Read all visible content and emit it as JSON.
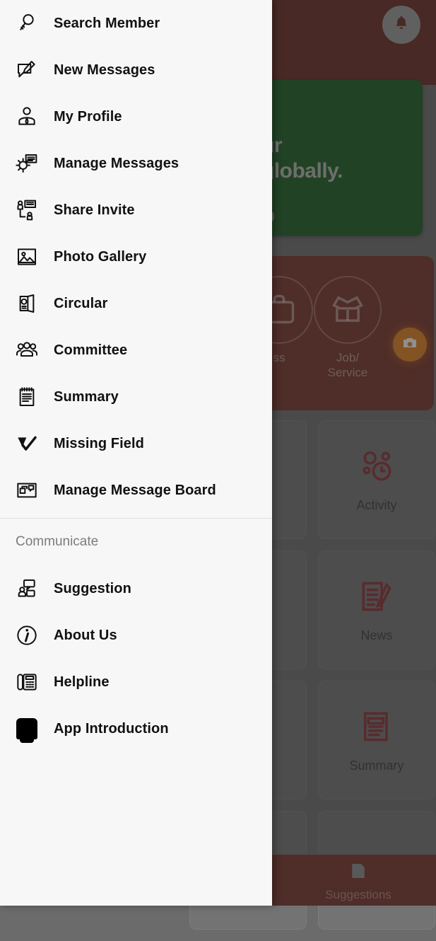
{
  "drawer": {
    "items": [
      {
        "label": "Search Member",
        "icon": "search-icon"
      },
      {
        "label": "New Messages",
        "icon": "new-message-icon"
      },
      {
        "label": "My Profile",
        "icon": "profile-icon"
      },
      {
        "label": "Manage Messages",
        "icon": "manage-messages-icon"
      },
      {
        "label": "Share Invite",
        "icon": "share-invite-icon"
      },
      {
        "label": "Photo Gallery",
        "icon": "photo-gallery-icon"
      },
      {
        "label": "Circular",
        "icon": "circular-icon"
      },
      {
        "label": "Committee",
        "icon": "committee-icon"
      },
      {
        "label": "Summary",
        "icon": "summary-icon"
      },
      {
        "label": "Missing Field",
        "icon": "missing-field-icon"
      },
      {
        "label": "Manage Message Board",
        "icon": "message-board-icon"
      }
    ],
    "section_title": "Communicate",
    "section_items": [
      {
        "label": "Suggestion",
        "icon": "suggestion-icon"
      },
      {
        "label": "About Us",
        "icon": "info-icon"
      },
      {
        "label": "Helpline",
        "icon": "telephone-icon"
      },
      {
        "label": "App Introduction",
        "icon": "app-intro-icon"
      }
    ]
  },
  "background": {
    "header": {
      "notification_icon": "bell-icon"
    },
    "banner": {
      "line1": "ur",
      "line2": "globally."
    },
    "tiles": [
      {
        "label": "ss",
        "icon": "briefcase-icon"
      },
      {
        "label": "Job/\nService",
        "icon": "open-box-icon"
      }
    ],
    "fab": {
      "icon": "camera-icon"
    },
    "cards": [
      {
        "label": "Activity",
        "icon": "gears-clock-icon"
      },
      {
        "label": "News",
        "icon": "notepad-pencil-icon"
      },
      {
        "label": "Summary",
        "icon": "notepad-icon"
      }
    ],
    "bottom_nav": [
      {
        "label": "Suggestions",
        "icon": "suggestions-icon"
      }
    ]
  },
  "colors": {
    "header_maroon": "#6b2b23",
    "tile_maroon": "#7a3328",
    "banner_green": "#1b5e20",
    "fab_orange": "#e8821e",
    "drawer_bg": "#f7f7f7",
    "card_icon_red": "#8e2f33"
  }
}
